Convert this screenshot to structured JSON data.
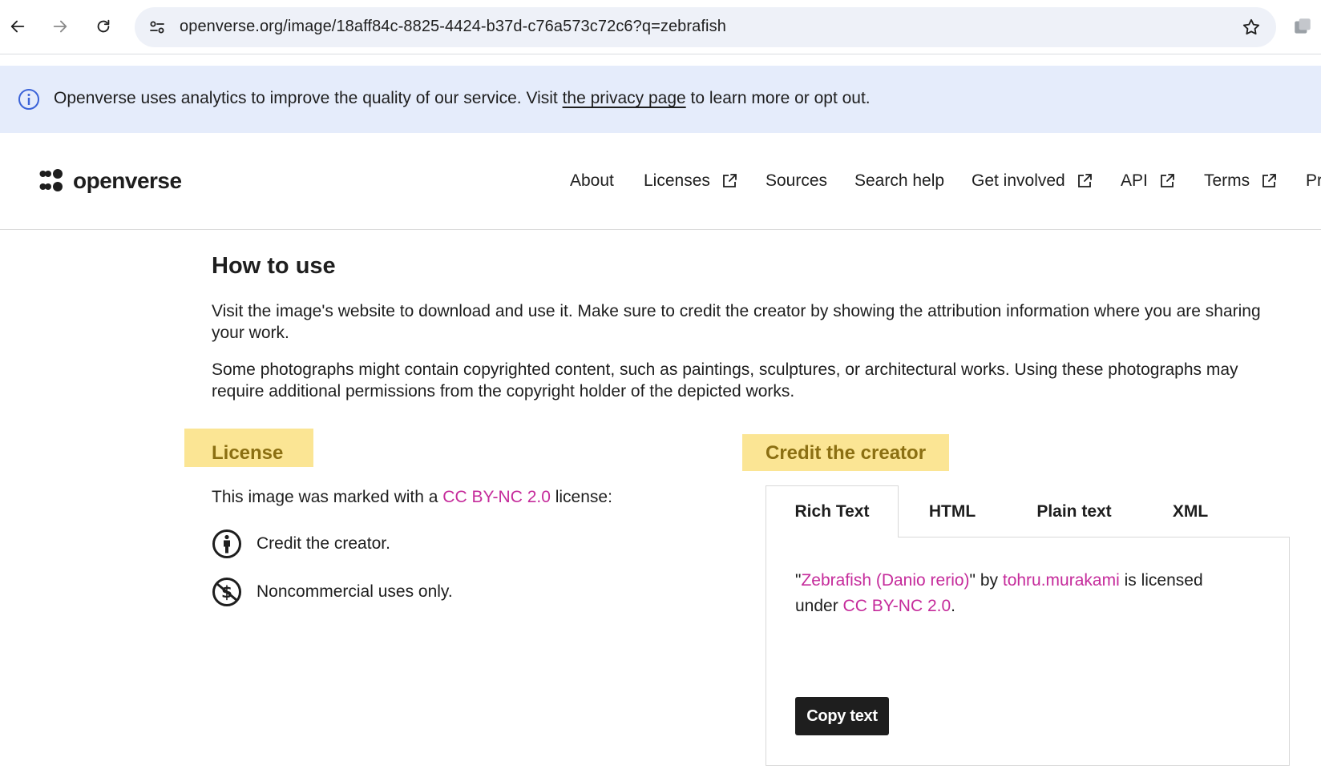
{
  "browser": {
    "url": "openverse.org/image/18aff84c-8825-4424-b37d-c76a573c72c6?q=zebrafish"
  },
  "banner": {
    "text_before": "Openverse uses analytics to improve the quality of our service. Visit ",
    "link": "the privacy page",
    "text_after": " to learn more or opt out."
  },
  "header": {
    "logo": "openverse",
    "nav": [
      {
        "label": "About",
        "external": false
      },
      {
        "label": "Licenses",
        "external": true
      },
      {
        "label": "Sources",
        "external": false
      },
      {
        "label": "Search help",
        "external": false
      },
      {
        "label": "Get involved",
        "external": true
      },
      {
        "label": "API",
        "external": true
      },
      {
        "label": "Terms",
        "external": true
      },
      {
        "label": "Pr",
        "external": false
      }
    ]
  },
  "how_to_use": {
    "title": "How to use",
    "para1": "Visit the image's website to download and use it. Make sure to credit the creator by showing the attribution information where you are sharing your work.",
    "para2": "Some photographs might contain copyrighted content, such as paintings, sculptures, or architectural works. Using these photographs may require additional permissions from the copyright holder of the depicted works."
  },
  "license": {
    "heading": "License",
    "line_before": "This image was marked with a ",
    "license_link": "CC BY-NC 2.0",
    "line_after": " license:",
    "items": [
      {
        "icon": "cc-by-icon",
        "text": "Credit the creator."
      },
      {
        "icon": "cc-nc-icon",
        "text": "Noncommercial uses only."
      }
    ]
  },
  "credit": {
    "heading": "Credit the creator",
    "tabs": [
      "Rich Text",
      "HTML",
      "Plain text",
      "XML"
    ],
    "active_tab": "Rich Text",
    "quote_open": "\"",
    "title_link": "Zebrafish (Danio rerio)",
    "quote_close": "\" by ",
    "creator_link": "tohru.murakami",
    "is_licensed": " is licensed under ",
    "license_link": "CC BY-NC 2.0",
    "period": ".",
    "copy_button": "Copy text"
  },
  "colors": {
    "accent_pink": "#c52b9b",
    "highlight_yellow": "#fbe594",
    "banner_blue": "#e5ecfb"
  }
}
